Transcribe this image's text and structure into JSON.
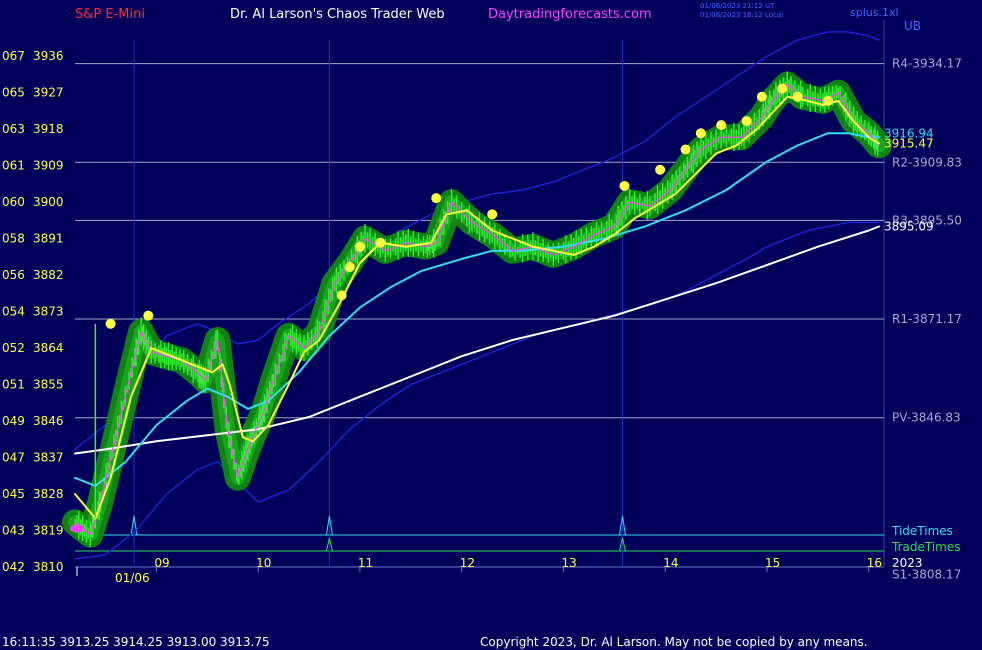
{
  "header": {
    "symbol": "S&P E-Mini",
    "site": "Dr. Al Larson's Chaos Trader Web",
    "url": "Daytradingforecasts.com",
    "stamp1": "01/06/2023 21:12 UT",
    "stamp2": "01/06/2023 16:12 Local",
    "corner": "splus.1xl",
    "ub": "UB"
  },
  "footer": {
    "quote": "16:11:35  3913.25 3914.25 3913.00 3913.75",
    "copyright": "Copyright 2023, Dr. Al Larson. May not be copied by any means."
  },
  "colors": {
    "background": "#00005a",
    "price": "#33ee33",
    "halo": "#118811",
    "fast_avg": "#ffff40",
    "slow_avg": "#33ddee",
    "long_avg": "#ffffff",
    "band": "#1a2ae0",
    "mid": "#ff40ff",
    "level": "#a8a8c8",
    "tide": "#33ddee",
    "trade": "#33dd55"
  },
  "chart_data": {
    "type": "line",
    "title": "S&P E-Mini",
    "ylim": [
      3810,
      3940
    ],
    "y_ticks": [
      {
        "left": "067",
        "price": "3936",
        "v": 3936
      },
      {
        "left": "065",
        "price": "3927",
        "v": 3927
      },
      {
        "left": "063",
        "price": "3918",
        "v": 3918
      },
      {
        "left": "061",
        "price": "3909",
        "v": 3909
      },
      {
        "left": "060",
        "price": "3900",
        "v": 3900
      },
      {
        "left": "058",
        "price": "3891",
        "v": 3891
      },
      {
        "left": "056",
        "price": "3882",
        "v": 3882
      },
      {
        "left": "054",
        "price": "3873",
        "v": 3873
      },
      {
        "left": "052",
        "price": "3864",
        "v": 3864
      },
      {
        "left": "051",
        "price": "3855",
        "v": 3855
      },
      {
        "left": "049",
        "price": "3846",
        "v": 3846
      },
      {
        "left": "047",
        "price": "3837",
        "v": 3837
      },
      {
        "left": "045",
        "price": "3828",
        "v": 3828
      },
      {
        "left": "043",
        "price": "3819",
        "v": 3819
      },
      {
        "left": "042",
        "price": "3810",
        "v": 3810
      }
    ],
    "x_hours": [
      {
        "label": "09",
        "t": 9
      },
      {
        "label": "10",
        "t": 10
      },
      {
        "label": "11",
        "t": 11
      },
      {
        "label": "12",
        "t": 12
      },
      {
        "label": "13",
        "t": 13
      },
      {
        "label": "14",
        "t": 14
      },
      {
        "label": "15",
        "t": 15
      },
      {
        "label": "16",
        "t": 16
      }
    ],
    "x_range": [
      8.2,
      16.15
    ],
    "date_label": "01/06",
    "year_label": "2023",
    "levels": [
      {
        "name": "R4",
        "label": "R4-3934.17",
        "value": 3934.17
      },
      {
        "name": "R2",
        "label": "R2-3909.83",
        "value": 3909.83
      },
      {
        "name": "R3",
        "label": "R3-3895.50",
        "value": 3895.5
      },
      {
        "name": "R1",
        "label": "R1-3871.17",
        "value": 3871.17
      },
      {
        "name": "PV",
        "label": "PV-3846.83",
        "value": 3846.83
      },
      {
        "name": "S1",
        "label": "S1-3808.17",
        "value": 3808.17
      }
    ],
    "right_labels": [
      {
        "text": "3916.94",
        "value": 3916.94,
        "color": "#33ddee"
      },
      {
        "text": "3915.47",
        "value": 3914.5,
        "color": "#ffff40"
      },
      {
        "text": "3895.09",
        "value": 3894.0,
        "color": "#ffffff"
      }
    ],
    "tide_times_label": "TideTimes",
    "trade_times_label": "TradeTimes",
    "tide_times": [
      8.78,
      10.7,
      13.58
    ],
    "trade_times": [
      10.7,
      13.58
    ],
    "price": {
      "t": [
        8.2,
        8.35,
        8.45,
        8.6,
        8.75,
        8.85,
        8.95,
        9.1,
        9.25,
        9.4,
        9.48,
        9.6,
        9.7,
        9.8,
        9.88,
        9.96,
        10.05,
        10.15,
        10.3,
        10.45,
        10.6,
        10.75,
        10.9,
        11.05,
        11.25,
        11.45,
        11.65,
        11.75,
        11.9,
        12.1,
        12.3,
        12.5,
        12.7,
        12.9,
        13.1,
        13.3,
        13.5,
        13.65,
        13.85,
        14.05,
        14.2,
        14.35,
        14.55,
        14.75,
        14.95,
        15.05,
        15.2,
        15.35,
        15.55,
        15.7,
        15.85,
        16.0,
        16.1
      ],
      "v": [
        3821,
        3818,
        3826,
        3842,
        3858,
        3868,
        3863,
        3862,
        3861,
        3858,
        3856,
        3866,
        3844,
        3832,
        3838,
        3843,
        3848,
        3856,
        3867,
        3864,
        3868,
        3880,
        3885,
        3891,
        3888,
        3890,
        3889,
        3890,
        3900,
        3895,
        3892,
        3888,
        3889,
        3887,
        3889,
        3892,
        3894,
        3900,
        3899,
        3903,
        3908,
        3913,
        3916,
        3916,
        3921,
        3925,
        3929,
        3926,
        3925,
        3927,
        3920,
        3917,
        3914
      ]
    },
    "fast_avg": {
      "t": [
        8.2,
        8.4,
        8.55,
        8.75,
        8.95,
        9.15,
        9.35,
        9.55,
        9.65,
        9.72,
        9.85,
        9.95,
        10.1,
        10.3,
        10.45,
        10.6,
        10.8,
        11.0,
        11.2,
        11.45,
        11.7,
        11.85,
        12.05,
        12.3,
        12.5,
        12.7,
        12.9,
        13.1,
        13.3,
        13.5,
        13.7,
        13.9,
        14.1,
        14.3,
        14.5,
        14.7,
        14.9,
        15.05,
        15.2,
        15.4,
        15.55,
        15.7,
        15.85,
        16.0,
        16.1
      ],
      "v": [
        3828,
        3822,
        3832,
        3852,
        3864,
        3862,
        3860,
        3858,
        3860,
        3855,
        3842,
        3841,
        3845,
        3855,
        3863,
        3866,
        3875,
        3885,
        3890,
        3889,
        3890,
        3897,
        3898,
        3893,
        3891,
        3889,
        3888,
        3887,
        3889,
        3892,
        3896,
        3899,
        3902,
        3907,
        3912,
        3914,
        3918,
        3922,
        3926,
        3925,
        3924,
        3925,
        3920,
        3916,
        3914.5
      ]
    },
    "slow_avg": {
      "t": [
        8.2,
        8.4,
        8.7,
        9.0,
        9.3,
        9.5,
        9.7,
        9.9,
        10.1,
        10.4,
        10.7,
        11.0,
        11.3,
        11.6,
        12.0,
        12.3,
        12.6,
        13.0,
        13.4,
        13.8,
        14.2,
        14.6,
        15.0,
        15.3,
        15.6,
        15.8,
        16.0,
        16.1
      ],
      "v": [
        3832,
        3830,
        3836,
        3845,
        3851,
        3854,
        3852,
        3849,
        3851,
        3858,
        3867,
        3874,
        3879,
        3883,
        3886,
        3888,
        3888,
        3889,
        3891,
        3894,
        3898,
        3903,
        3910,
        3914,
        3917,
        3917,
        3916,
        3916
      ]
    },
    "long_avg": {
      "t": [
        8.2,
        8.5,
        9.0,
        9.5,
        10.0,
        10.5,
        11.0,
        11.5,
        12.0,
        12.5,
        13.0,
        13.5,
        14.0,
        14.5,
        15.0,
        15.5,
        16.0,
        16.1
      ],
      "v": [
        3838,
        3839,
        3841,
        3842.5,
        3844,
        3847,
        3852,
        3857,
        3862,
        3866,
        3869,
        3872,
        3876,
        3880,
        3884.5,
        3889,
        3893,
        3894
      ]
    },
    "upper_band": {
      "t": [
        8.2,
        8.5,
        8.8,
        9.1,
        9.4,
        9.6,
        9.8,
        10.0,
        10.2,
        10.5,
        10.8,
        11.1,
        11.4,
        11.7,
        12.0,
        12.3,
        12.6,
        12.9,
        13.2,
        13.5,
        13.8,
        14.1,
        14.4,
        14.7,
        15.0,
        15.3,
        15.6,
        15.8,
        16.0,
        16.1
      ],
      "v": [
        3839,
        3845,
        3857,
        3867,
        3870,
        3868,
        3865,
        3866,
        3870,
        3875,
        3882,
        3888,
        3893,
        3897,
        3900,
        3902,
        3903,
        3905,
        3908,
        3911,
        3915,
        3921,
        3926,
        3931,
        3936,
        3940,
        3942,
        3942,
        3941,
        3940
      ]
    },
    "lower_band": {
      "t": [
        8.2,
        8.5,
        8.8,
        9.1,
        9.4,
        9.6,
        9.8,
        10.0,
        10.3,
        10.6,
        10.9,
        11.2,
        11.5,
        11.8,
        12.1,
        12.4,
        12.7,
        13.0,
        13.3,
        13.6,
        13.9,
        14.2,
        14.5,
        14.8,
        15.0,
        15.2,
        15.4,
        15.6,
        15.8,
        16.0,
        16.1
      ],
      "v": [
        3812,
        3813,
        3819,
        3828,
        3834,
        3836,
        3831,
        3826,
        3829,
        3836,
        3844,
        3850,
        3855,
        3858,
        3861,
        3864,
        3867,
        3869,
        3871,
        3873,
        3875,
        3878,
        3882,
        3886,
        3889,
        3891,
        3893,
        3894,
        3895,
        3895,
        3895
      ]
    },
    "highlights": [
      {
        "t": 8.92,
        "v": 3872
      },
      {
        "t": 8.55,
        "v": 3870
      },
      {
        "t": 10.82,
        "v": 3877
      },
      {
        "t": 10.9,
        "v": 3884
      },
      {
        "t": 11.0,
        "v": 3889
      },
      {
        "t": 11.2,
        "v": 3890
      },
      {
        "t": 11.75,
        "v": 3901
      },
      {
        "t": 12.3,
        "v": 3897
      },
      {
        "t": 13.6,
        "v": 3904
      },
      {
        "t": 13.95,
        "v": 3908
      },
      {
        "t": 14.2,
        "v": 3913
      },
      {
        "t": 14.35,
        "v": 3917
      },
      {
        "t": 14.55,
        "v": 3919
      },
      {
        "t": 14.8,
        "v": 3920
      },
      {
        "t": 14.95,
        "v": 3926
      },
      {
        "t": 15.15,
        "v": 3928
      },
      {
        "t": 15.3,
        "v": 3926
      },
      {
        "t": 15.6,
        "v": 3925
      }
    ]
  }
}
